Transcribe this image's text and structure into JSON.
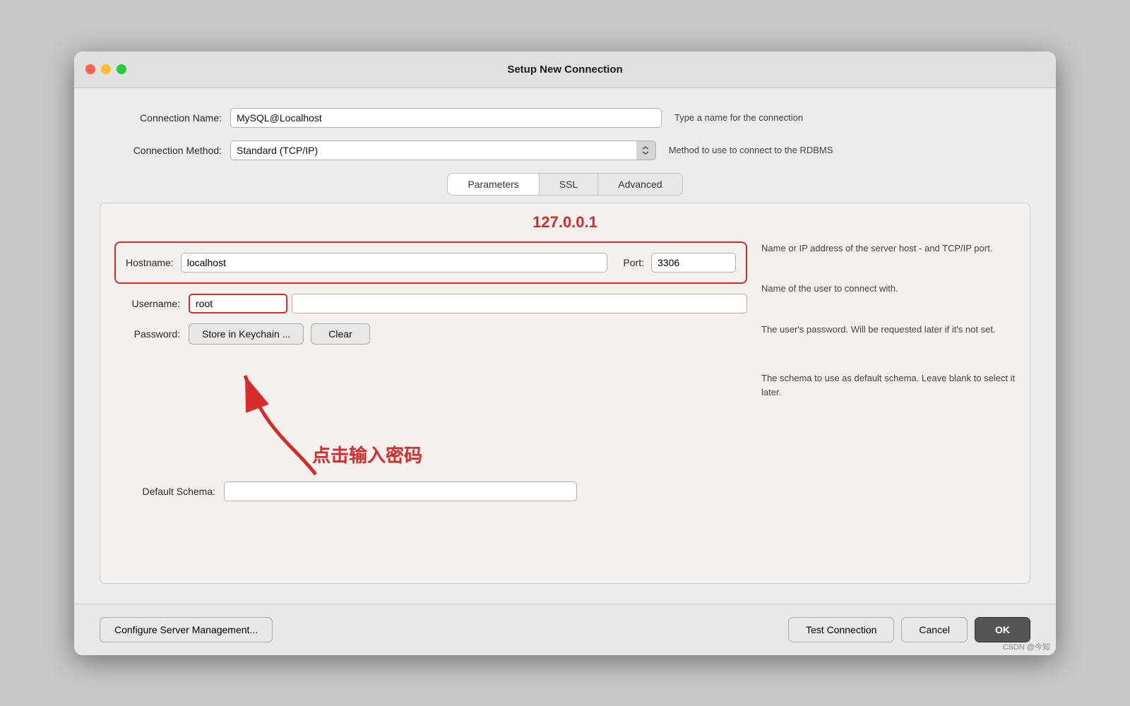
{
  "window": {
    "title": "Setup New Connection"
  },
  "form": {
    "connection_name_label": "Connection Name:",
    "connection_name_value": "MySQL@Localhost",
    "connection_name_hint": "Type a name for the connection",
    "connection_method_label": "Connection Method:",
    "connection_method_value": "Standard (TCP/IP)",
    "connection_method_hint": "Method to use to connect to the RDBMS"
  },
  "tabs": {
    "parameters_label": "Parameters",
    "ssl_label": "SSL",
    "advanced_label": "Advanced",
    "active": "Parameters"
  },
  "parameters": {
    "overlay_ip": "127.0.0.1",
    "hostname_label": "Hostname:",
    "hostname_value": "localhost",
    "port_label": "Port:",
    "port_value": "3306",
    "host_hint": "Name or IP address of the server host - and TCP/IP port.",
    "username_label": "Username:",
    "username_value": "root",
    "username_hint": "Name of the user to connect with.",
    "password_label": "Password:",
    "btn_keychain": "Store in Keychain ...",
    "btn_clear": "Clear",
    "password_hint": "The user's password. Will be requested later if it's not set.",
    "default_schema_label": "Default Schema:",
    "default_schema_value": "",
    "schema_hint": "The schema to use as default schema. Leave blank to select it later.",
    "annotation_text": "点击输入密码"
  },
  "bottom": {
    "btn_configure": "Configure Server Management...",
    "btn_test": "Test Connection",
    "btn_cancel": "Cancel",
    "btn_ok": "OK"
  },
  "watermark": "CSDN @今知"
}
